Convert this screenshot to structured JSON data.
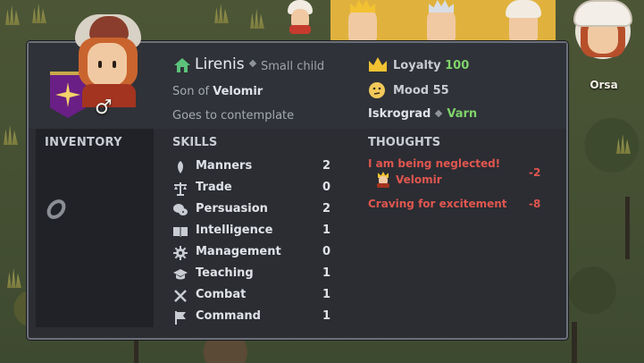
{
  "top_bar": {
    "right_portrait_name": "Orsa"
  },
  "character": {
    "name": "Lirenis",
    "age_group": "Small child",
    "relation_prefix": "Son of",
    "relation_name": "Velomir",
    "activity": "Goes to contemplate",
    "gender_symbol": "♂"
  },
  "stats": {
    "loyalty_label": "Loyalty",
    "loyalty_value": "100",
    "mood_label": "Mood",
    "mood_value": "55",
    "settlement": "Iskrograd",
    "region": "Varn"
  },
  "inventory": {
    "title": "INVENTORY"
  },
  "skills": {
    "title": "SKILLS",
    "items": [
      {
        "label": "Manners",
        "value": "2",
        "icon": "manners-icon"
      },
      {
        "label": "Trade",
        "value": "0",
        "icon": "scales-icon"
      },
      {
        "label": "Persuasion",
        "value": "2",
        "icon": "speech-icon"
      },
      {
        "label": "Intelligence",
        "value": "1",
        "icon": "book-icon"
      },
      {
        "label": "Management",
        "value": "0",
        "icon": "gear-icon"
      },
      {
        "label": "Teaching",
        "value": "1",
        "icon": "graduation-cap-icon"
      },
      {
        "label": "Combat",
        "value": "1",
        "icon": "crossed-swords-icon"
      },
      {
        "label": "Command",
        "value": "1",
        "icon": "flag-icon"
      }
    ]
  },
  "thoughts": {
    "title": "THOUGHTS",
    "items": [
      {
        "text": "I am being neglected!",
        "value": "-2",
        "subject": "Velomir"
      },
      {
        "text": "Craving for excitement",
        "value": "-8"
      }
    ]
  },
  "colors": {
    "positive": "#7fd36a",
    "negative": "#e0564f",
    "panel": "#2b2d33",
    "banner": "#6a1f86"
  }
}
